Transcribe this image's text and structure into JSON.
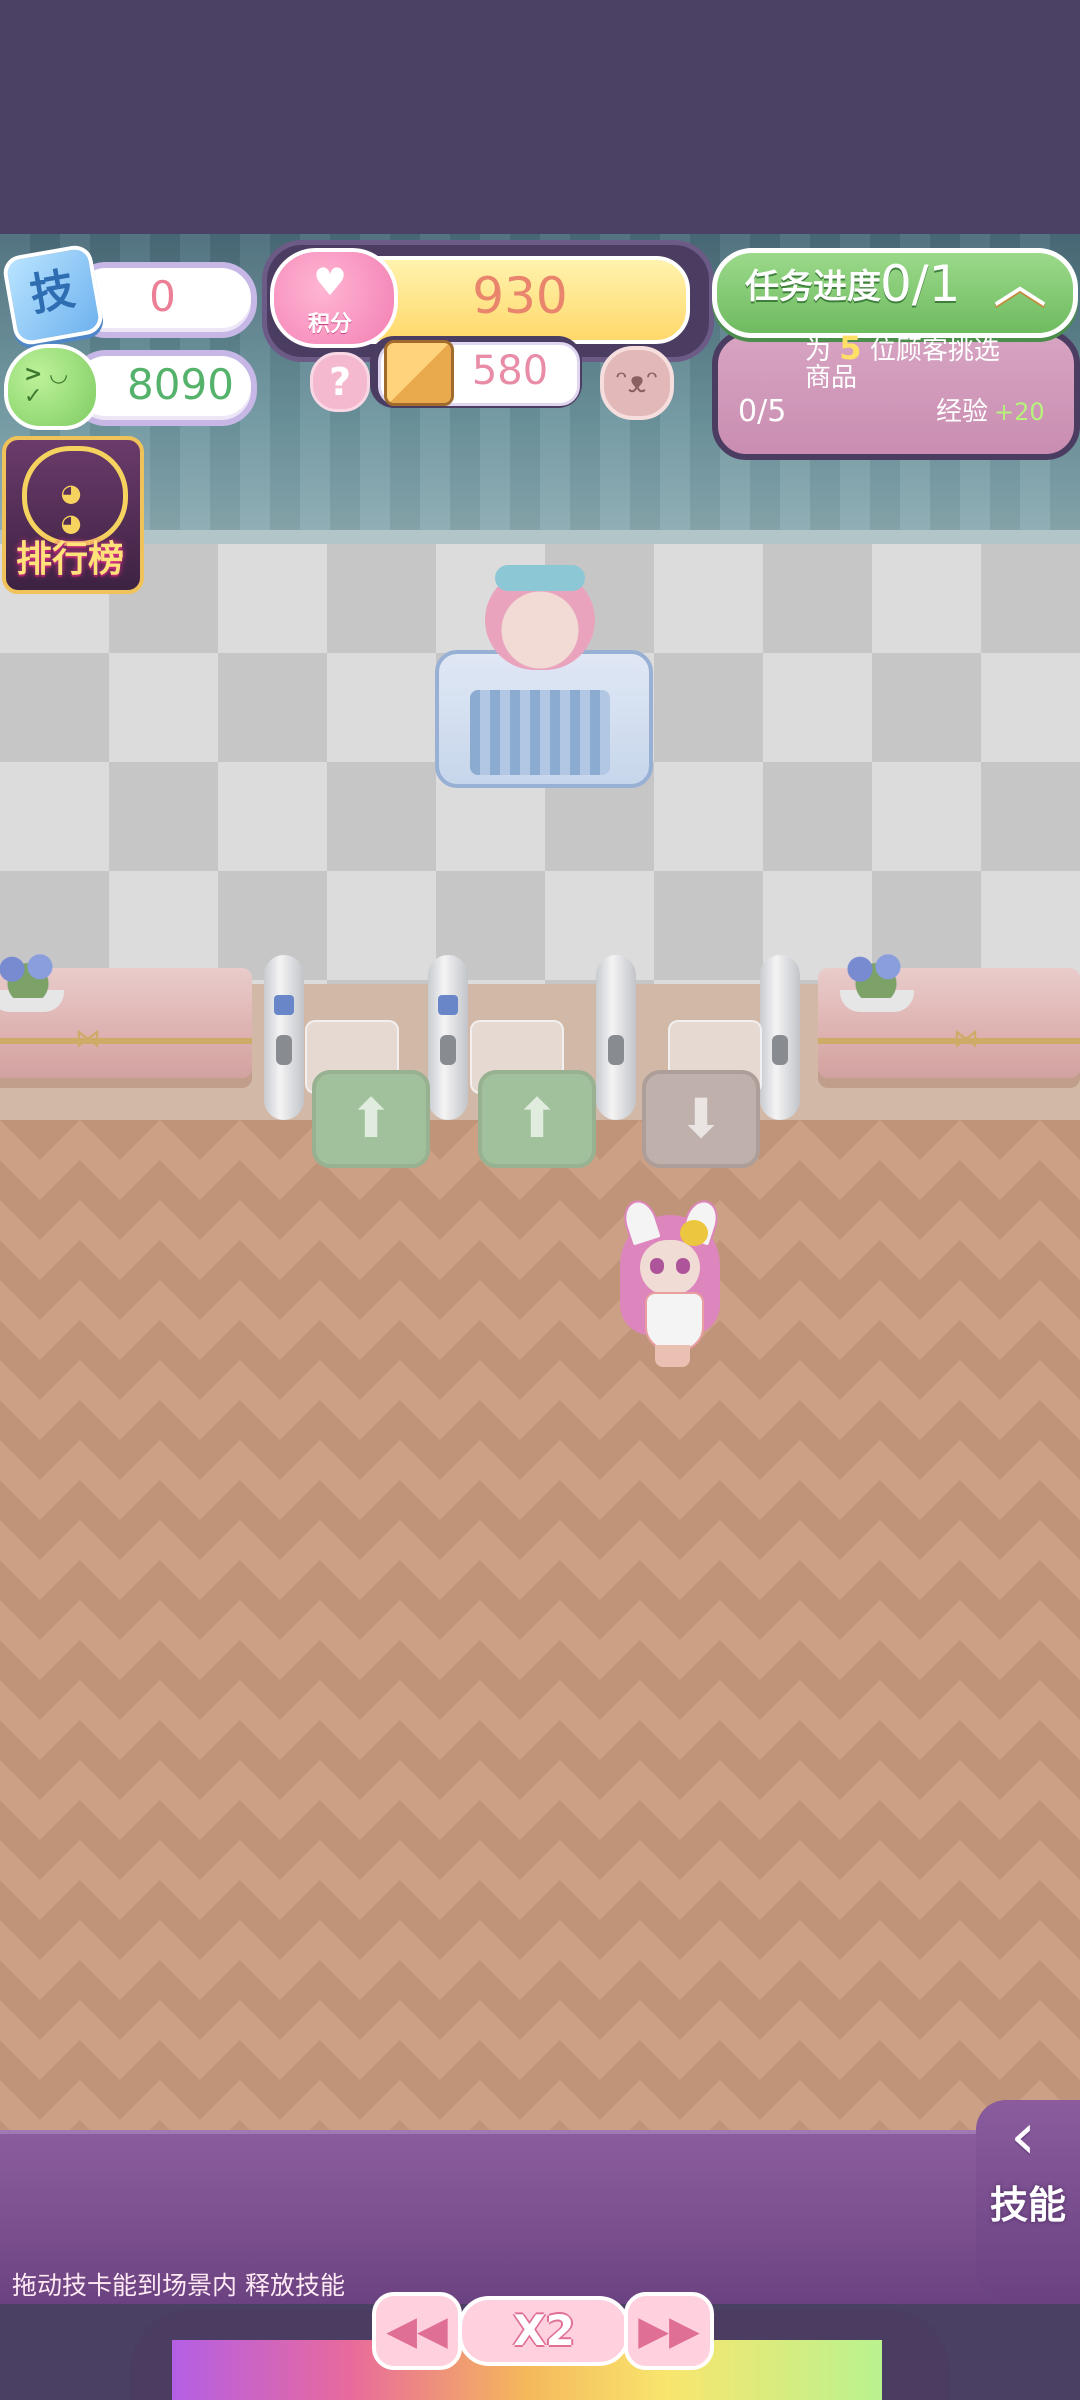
{
  "hud": {
    "skill_icon_text": "技",
    "skill_points": "0",
    "coins": "8090",
    "ranking_label": "排行榜"
  },
  "score": {
    "value": "930",
    "label": "积分",
    "box_value": "580",
    "help_text": "?"
  },
  "task": {
    "title": "任务进度",
    "count": "0/1",
    "desc_prefix": "为",
    "desc_number": "5",
    "desc_suffix": "位顾客挑选",
    "desc_line2": "商品",
    "progress": "0/5",
    "exp_label": "经验",
    "exp_value": "+20"
  },
  "tray": {
    "hint": "拖动技卡能到场景内  释放技能",
    "skill_tab_label": "技能"
  },
  "speed": {
    "multiplier": "X2"
  },
  "icons": {
    "skill": "skill-badge-icon",
    "coin": "green-slime-coin-icon",
    "ranking": "cat-headphones-icon",
    "score": "piggy-bank-heart-icon",
    "box": "cardboard-box-icon",
    "help": "question-mark-icon",
    "bunny": "bunny-avatar-icon",
    "chevron": "chevron-up-icon",
    "skill_tab": "chevron-left-icon",
    "rewind": "rewind-icon",
    "fast_forward": "fast-forward-icon"
  }
}
